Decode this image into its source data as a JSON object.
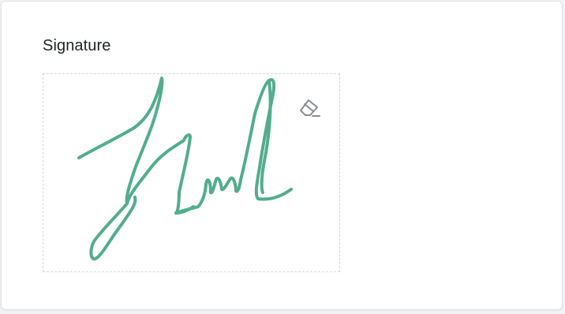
{
  "form": {
    "signature_label": "Signature"
  },
  "signature_pad": {
    "stroke_color": "#52ad8f",
    "clear_icon": "eraser-icon",
    "icon_color": "#8a8d93"
  }
}
